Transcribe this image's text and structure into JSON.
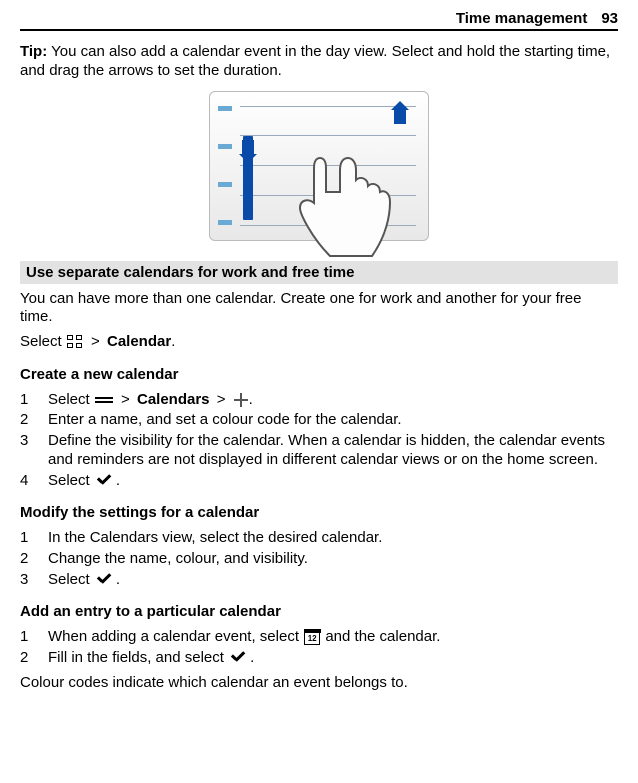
{
  "header": {
    "section": "Time management",
    "page": "93"
  },
  "tip": {
    "label": "Tip:",
    "text": "You can also add a calendar event in the day view. Select and hold the starting time, and drag the arrows to set the duration."
  },
  "section1": {
    "bar": "Use separate calendars for work and free time",
    "intro": "You can have more than one calendar. Create one for work and another for your free time.",
    "select_prefix": "Select",
    "calendar_label": "Calendar",
    "gt": ">"
  },
  "create": {
    "heading": "Create a new calendar",
    "s1_prefix": "Select",
    "s1_mid": "Calendars",
    "gt": ">",
    "s2": "Enter a name, and set a colour code for the calendar.",
    "s3": "Define the visibility for the calendar. When a calendar is hidden, the calendar events and reminders are not displayed in different calendar views or on the home screen.",
    "s4_prefix": "Select",
    "dot": "."
  },
  "modify": {
    "heading": "Modify the settings for a calendar",
    "s1": "In the Calendars view, select the desired calendar.",
    "s2": "Change the name, colour, and visibility.",
    "s3_prefix": "Select",
    "dot": "."
  },
  "add": {
    "heading": "Add an entry to a particular calendar",
    "s1_prefix": "When adding a calendar event, select",
    "s1_suffix": "and the calendar.",
    "s2_prefix": "Fill in the fields, and select",
    "dot": "."
  },
  "footer": "Colour codes indicate which calendar an event belongs to."
}
